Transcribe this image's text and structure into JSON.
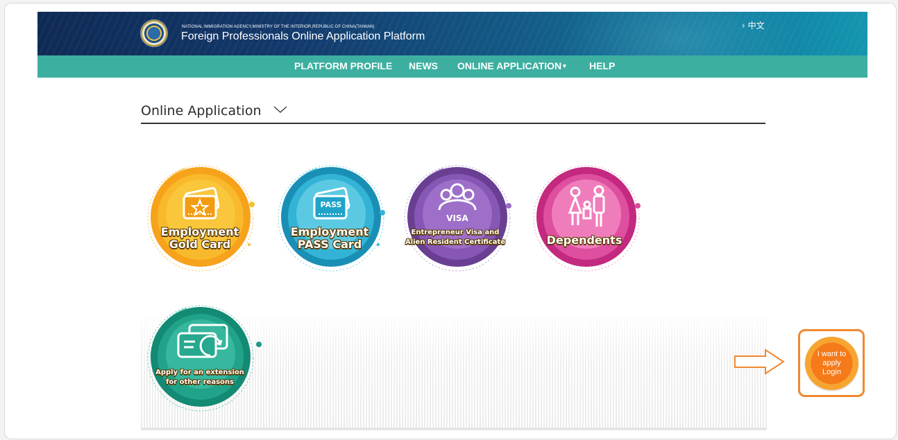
{
  "header": {
    "agency": "NATIONAL IMMIGRATION AGENCY,MINISTRY OF THE INTERIOR,REPUBLIC OF CHINA(TAIWAN)",
    "title": "Foreign Professionals Online Application Platform",
    "language_link": "› 中文"
  },
  "nav": {
    "items": [
      {
        "label": "PLATFORM PROFILE"
      },
      {
        "label": "NEWS"
      },
      {
        "label": "ONLINE APPLICATION"
      },
      {
        "label": "HELP"
      }
    ],
    "dropdown_caret": "▾"
  },
  "section": {
    "title": "Online Application"
  },
  "applications": [
    {
      "line1": "Employment",
      "line2": "Gold Card",
      "badge_text": "",
      "icon": "gold-card-icon",
      "color": "#f39c12"
    },
    {
      "line1": "Employment",
      "line2": "PASS Card",
      "badge_text": "PASS",
      "icon": "pass-card-icon",
      "color": "#1fa3c8"
    },
    {
      "line1": "Entrepreneur Visa and",
      "line2": "Alien Resident Certificate",
      "badge_text": "VISA",
      "icon": "people-group-icon",
      "color": "#8e59b5"
    },
    {
      "line1": "Dependents",
      "line2": "",
      "badge_text": "",
      "icon": "family-icon",
      "color": "#d2509a"
    },
    {
      "line1": "Apply for an extension",
      "line2": "for other reasons",
      "badge_text": "",
      "icon": "card-extension-icon",
      "color": "#23a28b"
    }
  ],
  "login": {
    "line1": "I want to",
    "line2": "apply",
    "line3": "Login",
    "accent": "#f0872f"
  }
}
